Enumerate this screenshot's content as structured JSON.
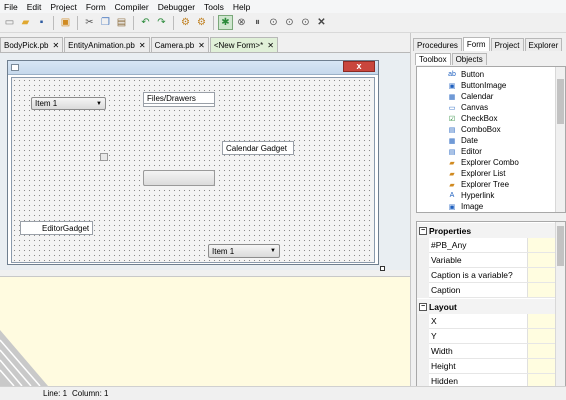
{
  "menubar": [
    "File",
    "Edit",
    "Project",
    "Form",
    "Compiler",
    "Debugger",
    "Tools",
    "Help"
  ],
  "toolbar_icons": [
    "new-file-icon",
    "open-icon",
    "save-icon",
    "save-all-icon",
    "cut-icon",
    "copy-icon",
    "paste-icon",
    "undo-icon",
    "redo-icon",
    "compile-icon",
    "run-icon",
    "debug-icon",
    "stop-icon",
    "pause-icon",
    "step-icon",
    "step-over-icon",
    "step-out-icon",
    "kill-icon"
  ],
  "file_tabs": [
    {
      "label": "BodyPick.pb"
    },
    {
      "label": "EntityAnimation.pb"
    },
    {
      "label": "Camera.pb"
    },
    {
      "label": "<New Form>*"
    }
  ],
  "form": {
    "combo1": "Item 1",
    "files_drawers": "Files/Drawers",
    "calendar_gadget": "Calendar Gadget",
    "editor_gadget": "EditorGadget",
    "combo2": "Item 1",
    "close": "x"
  },
  "panel_tabs": [
    "Procedures",
    "Form",
    "Project",
    "Explorer"
  ],
  "sub_tabs": [
    "Toolbox",
    "Objects"
  ],
  "toolbox": [
    "Button",
    "ButtonImage",
    "Calendar",
    "Canvas",
    "CheckBox",
    "ComboBox",
    "Date",
    "Editor",
    "Explorer Combo",
    "Explorer List",
    "Explorer Tree",
    "Hyperlink",
    "Image"
  ],
  "properties": {
    "section1": "Properties",
    "rows1": [
      "#PB_Any",
      "Variable",
      "Caption is a variable?",
      "Caption"
    ],
    "section2": "Layout",
    "rows2": [
      "X",
      "Y",
      "Width",
      "Height",
      "Hidden"
    ]
  },
  "status": {
    "line": "Line: 1",
    "column": "Column: 1"
  },
  "colors": {
    "active_tab": "#e0f0d8",
    "close_red": "#c9463d",
    "debug_bg": "#fffbe0"
  }
}
